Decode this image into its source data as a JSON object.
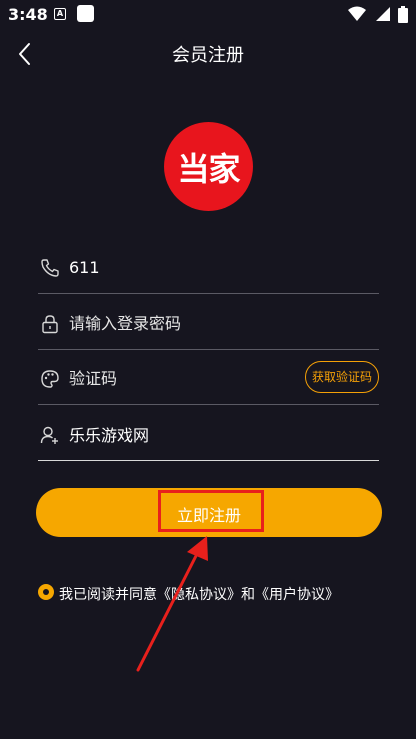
{
  "status_bar": {
    "time": "3:48",
    "app_icon_letter": "A"
  },
  "header": {
    "title": "会员注册"
  },
  "logo": {
    "text": "当家"
  },
  "form": {
    "phone": {
      "value": "611",
      "placeholder": ""
    },
    "password": {
      "value": "",
      "placeholder": "请输入登录密码"
    },
    "code": {
      "value": "",
      "placeholder": "验证码",
      "button_label": "获取验证码"
    },
    "invite": {
      "value": "乐乐游戏网",
      "placeholder": ""
    }
  },
  "register_button": {
    "label": "立即注册"
  },
  "agreement": {
    "prefix": "我已阅读并同意",
    "privacy_link": "《隐私协议》",
    "joiner": "和",
    "user_link": "《用户协议》"
  },
  "colors": {
    "background": "#16151f",
    "accent": "#f6a700",
    "logo_red": "#e8151d",
    "annotation_red": "#e8201c"
  }
}
